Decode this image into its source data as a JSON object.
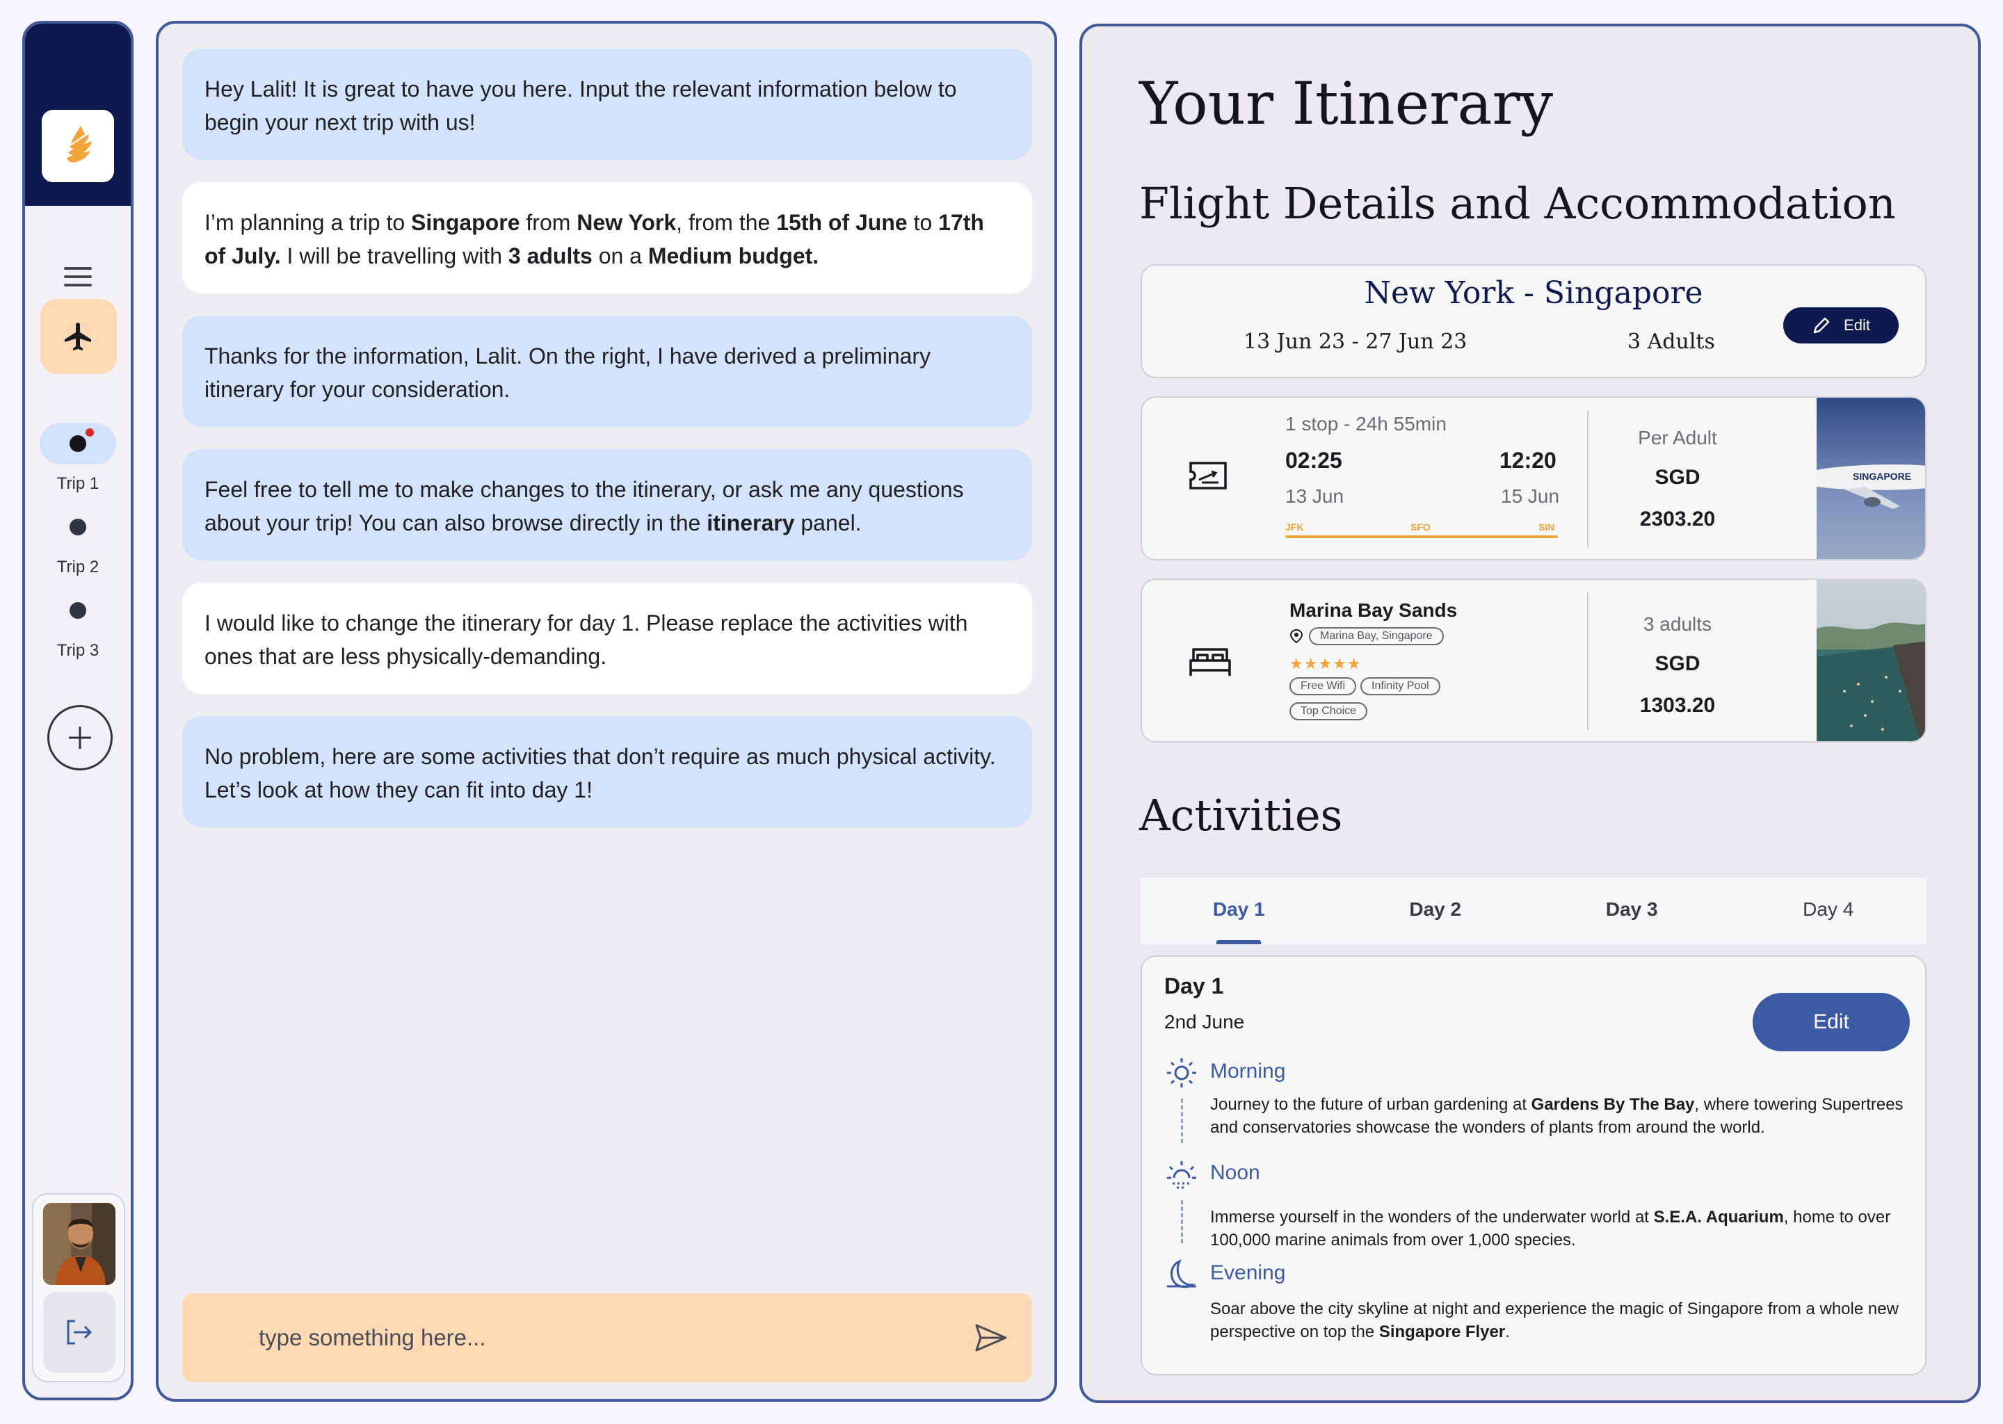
{
  "sidebar": {
    "trips": [
      {
        "label": "Trip 1"
      },
      {
        "label": "Trip 2"
      },
      {
        "label": "Trip 3"
      }
    ]
  },
  "chat": {
    "messages": [
      {
        "role": "bot",
        "parts": [
          {
            "t": "Hey Lalit! It is great to have you here. Input the relevant information below to begin your next trip with us!"
          }
        ]
      },
      {
        "role": "user",
        "parts": [
          {
            "t": "I’m planning a trip to "
          },
          {
            "t": "Singapore",
            "b": true
          },
          {
            "t": " from "
          },
          {
            "t": "New York",
            "b": true
          },
          {
            "t": ", from the "
          },
          {
            "t": "15th of June",
            "b": true
          },
          {
            "t": " to "
          },
          {
            "t": "17th of July.",
            "b": true
          },
          {
            "t": " I will be travelling with "
          },
          {
            "t": "3 adults",
            "b": true
          },
          {
            "t": " on a "
          },
          {
            "t": "Medium budget.",
            "b": true
          }
        ]
      },
      {
        "role": "bot",
        "parts": [
          {
            "t": "Thanks for the information, Lalit. On the right, I have derived a preliminary itinerary for your consideration."
          }
        ]
      },
      {
        "role": "bot",
        "parts": [
          {
            "t": "Feel free to tell me to make changes to the itinerary, or ask me any questions about your trip! You can also browse directly in the "
          },
          {
            "t": "itinerary",
            "b": true
          },
          {
            "t": " panel."
          }
        ]
      },
      {
        "role": "user",
        "parts": [
          {
            "t": "I would like to change the itinerary for day 1. Please replace the activities with ones that are less physically-demanding."
          }
        ]
      },
      {
        "role": "bot",
        "parts": [
          {
            "t": "No problem, here are some activities that don’t require as much physical activity. Let’s look at how they can fit into day 1!"
          }
        ]
      }
    ],
    "input_placeholder": "type something here..."
  },
  "itinerary": {
    "title": "Your Itinerary",
    "flight_section_title": "Flight Details and Accommodation",
    "route": {
      "title": "New York - Singapore",
      "dates": "13 Jun 23 - 27 Jun 23",
      "travellers": "3 Adults",
      "edit_label": "Edit"
    },
    "flight": {
      "stops": "1 stop - 24h 55min",
      "depart_time": "02:25",
      "arrive_time": "12:20",
      "depart_date": "13 Jun",
      "arrive_date": "15 Jun",
      "airports": [
        "JFK",
        "SFO",
        "SIN"
      ],
      "price_label": "Per Adult",
      "currency": "SGD",
      "price": "2303.20",
      "photo_text": "SINGAPORE"
    },
    "hotel": {
      "name": "Marina Bay Sands",
      "location": "Marina Bay, Singapore",
      "stars": "★★★★★",
      "amenities": [
        "Free Wifi",
        "Infinity Pool",
        "Top Choice"
      ],
      "price_label": "3 adults",
      "currency": "SGD",
      "price": "1303.20"
    },
    "activities_title": "Activities",
    "tabs": [
      "Day 1",
      "Day 2",
      "Day 3",
      "Day 4"
    ],
    "active_tab": 0,
    "day": {
      "title": "Day 1",
      "date": "2nd June",
      "edit_label": "Edit",
      "slots": [
        {
          "name": "Morning",
          "parts": [
            {
              "t": "Journey to the future of urban gardening at "
            },
            {
              "t": "Gardens By The Bay",
              "b": true
            },
            {
              "t": ", where towering Supertrees and conservatories showcase the wonders of plants from around the world."
            }
          ]
        },
        {
          "name": "Noon",
          "parts": [
            {
              "t": "Immerse yourself in the wonders of the underwater world at "
            },
            {
              "t": "S.E.A. Aquarium",
              "b": true
            },
            {
              "t": ", home to over 100,000 marine animals from over 1,000 species."
            }
          ]
        },
        {
          "name": "Evening",
          "parts": [
            {
              "t": "Soar above the city skyline at night and experience the magic of Singapore from a whole new perspective on top the "
            },
            {
              "t": "Singapore Flyer",
              "b": true
            },
            {
              "t": "."
            }
          ]
        }
      ]
    }
  },
  "colors": {
    "navy": "#0c1a4e",
    "accent_blue": "#3c5aa2",
    "panel_border": "#3f5a96",
    "bot_bubble": "#d3e3fb",
    "user_bubble": "#ffffff",
    "peach": "#fdd9b4",
    "orange": "#f2a33a"
  }
}
